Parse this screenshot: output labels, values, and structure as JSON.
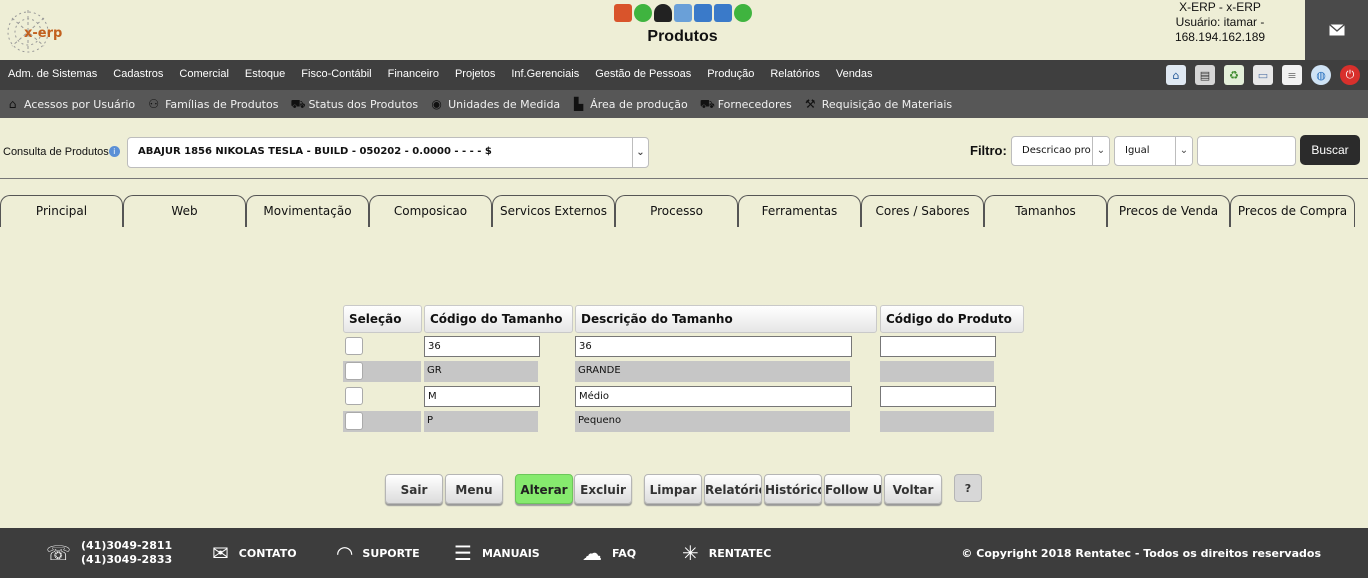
{
  "header": {
    "logo_text": "x-erp",
    "title": "Produtos",
    "user_line1": "X-ERP - x-ERP",
    "user_line2": "Usuário: itamar -",
    "user_line3": "168.194.162.189"
  },
  "toolbar_icons": [
    "pdf-icon",
    "add-icon",
    "user-add-icon",
    "truck-icon",
    "card-icon",
    "card-icon",
    "add-icon"
  ],
  "menu": {
    "items": [
      "Adm. de Sistemas",
      "Cadastros",
      "Comercial",
      "Estoque",
      "Fisco-Contábil",
      "Financeiro",
      "Projetos",
      "Inf.Gerenciais",
      "Gestão de Pessoas",
      "Produção",
      "Relatórios",
      "Vendas"
    ],
    "icons": [
      "home-icon",
      "print-icon",
      "recycle-icon",
      "document-icon",
      "notes-icon",
      "world-icon",
      "power-icon"
    ]
  },
  "submenu": {
    "items": [
      "Acessos por Usuário",
      "Famílias de Produtos",
      "Status dos Produtos",
      "Unidades de Medida",
      "Área de produção",
      "Fornecedores",
      "Requisição de Materiais"
    ]
  },
  "search": {
    "label": "Consulta de Produtos",
    "selected": "ABAJUR 1856 NIKOLAS TESLA - BUILD - 050202 - 0.0000 - - - - $",
    "filter_label": "Filtro:",
    "filter_field": "Descricao pro",
    "filter_operator": "Igual",
    "filter_value": "",
    "search_button": "Buscar"
  },
  "tabs": [
    "Principal",
    "Web",
    "Movimentação",
    "Composicao",
    "Servicos Externos",
    "Processo",
    "Ferramentas",
    "Cores / Sabores",
    "Tamanhos",
    "Precos de Venda",
    "Precos de Compra"
  ],
  "active_tab": "Tamanhos",
  "grid": {
    "columns": [
      "Seleção",
      "Código do Tamanho",
      "Descrição do Tamanho",
      "Código do Produto"
    ],
    "rows": [
      {
        "code": "36",
        "description": "36",
        "product_code": "",
        "style": "white"
      },
      {
        "code": "GR",
        "description": "GRANDE",
        "product_code": "",
        "style": "gray"
      },
      {
        "code": "M",
        "description": "Médio",
        "product_code": "",
        "style": "white"
      },
      {
        "code": "P",
        "description": "Pequeno",
        "product_code": "",
        "style": "gray"
      }
    ]
  },
  "actions": {
    "sair": "Sair",
    "menu": "Menu",
    "alterar": "Alterar",
    "excluir": "Excluir",
    "limpar": "Limpar",
    "relatorio": "Relatório",
    "historico": "Histórico",
    "followup": "Follow Up",
    "voltar": "Voltar",
    "help": "?"
  },
  "footer": {
    "phone1": "(41)3049-2811",
    "phone2": "(41)3049-2833",
    "contato": "CONTATO",
    "suporte": "SUPORTE",
    "manuais": "MANUAIS",
    "faq": "FAQ",
    "rentatec": "RENTATEC",
    "copyright": "© Copyright 2018 Rentatec - Todos os direitos reservados"
  }
}
